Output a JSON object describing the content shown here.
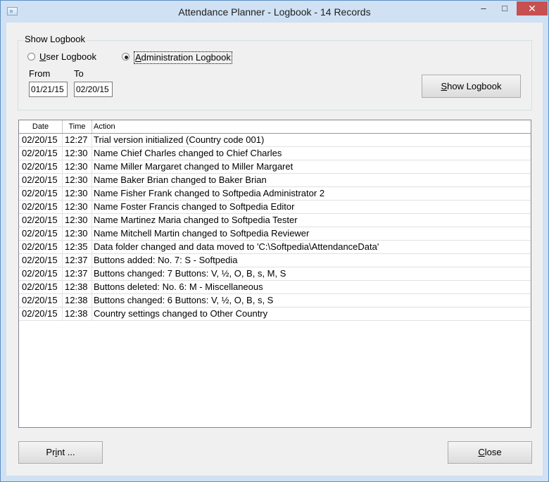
{
  "window": {
    "title": "Attendance Planner - Logbook - 14 Records",
    "minimize_glyph": "–",
    "maximize_glyph": "□",
    "close_glyph": "✕"
  },
  "show_logbook": {
    "group_label": "Show Logbook",
    "options": [
      {
        "label": "User Logbook",
        "selected": false
      },
      {
        "label": "Administration Logbook",
        "selected": true
      }
    ],
    "from_label": "From",
    "to_label": "To",
    "from_value": "01/21/15",
    "to_value": "02/20/15",
    "button_label": "Show Logbook"
  },
  "table": {
    "columns": [
      "Date",
      "Time",
      "Action"
    ],
    "rows": [
      {
        "date": "02/20/15",
        "time": "12:27",
        "action": "Trial version initialized (Country code 001)"
      },
      {
        "date": "02/20/15",
        "time": "12:30",
        "action": "Name Chief Charles changed to Chief Charles"
      },
      {
        "date": "02/20/15",
        "time": "12:30",
        "action": "Name Miller Margaret changed to Miller Margaret"
      },
      {
        "date": "02/20/15",
        "time": "12:30",
        "action": "Name Baker Brian changed to Baker Brian"
      },
      {
        "date": "02/20/15",
        "time": "12:30",
        "action": "Name Fisher Frank changed to Softpedia Administrator 2"
      },
      {
        "date": "02/20/15",
        "time": "12:30",
        "action": "Name Foster Francis changed to Softpedia Editor"
      },
      {
        "date": "02/20/15",
        "time": "12:30",
        "action": "Name Martinez Maria changed to Softpedia Tester"
      },
      {
        "date": "02/20/15",
        "time": "12:30",
        "action": "Name Mitchell Martin changed to Softpedia Reviewer"
      },
      {
        "date": "02/20/15",
        "time": "12:35",
        "action": "Data folder changed and data moved to 'C:\\Softpedia\\AttendanceData'"
      },
      {
        "date": "02/20/15",
        "time": "12:37",
        "action": "Buttons added: No. 7: S - Softpedia"
      },
      {
        "date": "02/20/15",
        "time": "12:37",
        "action": "Buttons changed: 7 Buttons: V, ½, O, B, s, M, S"
      },
      {
        "date": "02/20/15",
        "time": "12:38",
        "action": "Buttons deleted: No. 6: M - Miscellaneous"
      },
      {
        "date": "02/20/15",
        "time": "12:38",
        "action": "Buttons changed: 6 Buttons: V, ½, O, B, s, S"
      },
      {
        "date": "02/20/15",
        "time": "12:38",
        "action": "Country settings changed to Other Country"
      }
    ]
  },
  "footer": {
    "print_label": "Print ...",
    "close_label": "Close"
  }
}
